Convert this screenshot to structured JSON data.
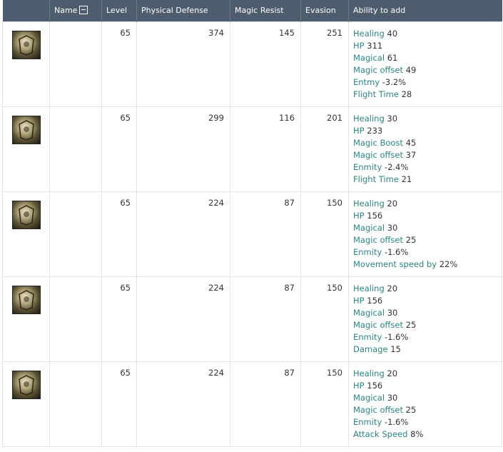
{
  "headers": {
    "name": "Name",
    "level": "Level",
    "physical_defense": "Physical Defense",
    "magic_resist": "Magic Resist",
    "evasion": "Evasion",
    "ability": "Ability to add"
  },
  "rows": [
    {
      "icon": "helmet-icon",
      "level": "65",
      "pdef": "374",
      "mres": "145",
      "eva": "251",
      "abilities": [
        {
          "key": "Healing",
          "val": "40"
        },
        {
          "key": "HP",
          "val": "311"
        },
        {
          "key": "Magical",
          "val": "61"
        },
        {
          "key": "Magic offset",
          "val": "49"
        },
        {
          "key": "Entmy",
          "val": "-3.2%"
        },
        {
          "key": "Flight Time",
          "val": "28"
        }
      ]
    },
    {
      "icon": "chest-armor-icon",
      "level": "65",
      "pdef": "299",
      "mres": "116",
      "eva": "201",
      "abilities": [
        {
          "key": "Healing",
          "val": "30"
        },
        {
          "key": "HP",
          "val": "233"
        },
        {
          "key": "Magic Boost",
          "val": "45"
        },
        {
          "key": "Magic offset",
          "val": "37"
        },
        {
          "key": "Enmity",
          "val": "-2.4%"
        },
        {
          "key": "Flight Time",
          "val": "21"
        }
      ]
    },
    {
      "icon": "boots-icon",
      "level": "65",
      "pdef": "224",
      "mres": "87",
      "eva": "150",
      "abilities": [
        {
          "key": "Healing",
          "val": "20"
        },
        {
          "key": "HP",
          "val": "156"
        },
        {
          "key": "Magical",
          "val": "30"
        },
        {
          "key": "Magic offset",
          "val": "25"
        },
        {
          "key": "Enmity",
          "val": "-1.6%"
        },
        {
          "key": "Movement speed by",
          "val": "22%"
        }
      ]
    },
    {
      "icon": "shoulder-guard-icon",
      "level": "65",
      "pdef": "224",
      "mres": "87",
      "eva": "150",
      "abilities": [
        {
          "key": "Healing",
          "val": "20"
        },
        {
          "key": "HP",
          "val": "156"
        },
        {
          "key": "Magical",
          "val": "30"
        },
        {
          "key": "Magic offset",
          "val": "25"
        },
        {
          "key": "Enmity",
          "val": "-1.6%"
        },
        {
          "key": "Damage",
          "val": "15"
        }
      ]
    },
    {
      "icon": "gloves-icon",
      "level": "65",
      "pdef": "224",
      "mres": "87",
      "eva": "150",
      "abilities": [
        {
          "key": "Healing",
          "val": "20"
        },
        {
          "key": "HP",
          "val": "156"
        },
        {
          "key": "Magical",
          "val": "30"
        },
        {
          "key": "Magic offset",
          "val": "25"
        },
        {
          "key": "Enmity",
          "val": "-1.6%"
        },
        {
          "key": "Attack Speed",
          "val": "8%"
        }
      ]
    }
  ]
}
